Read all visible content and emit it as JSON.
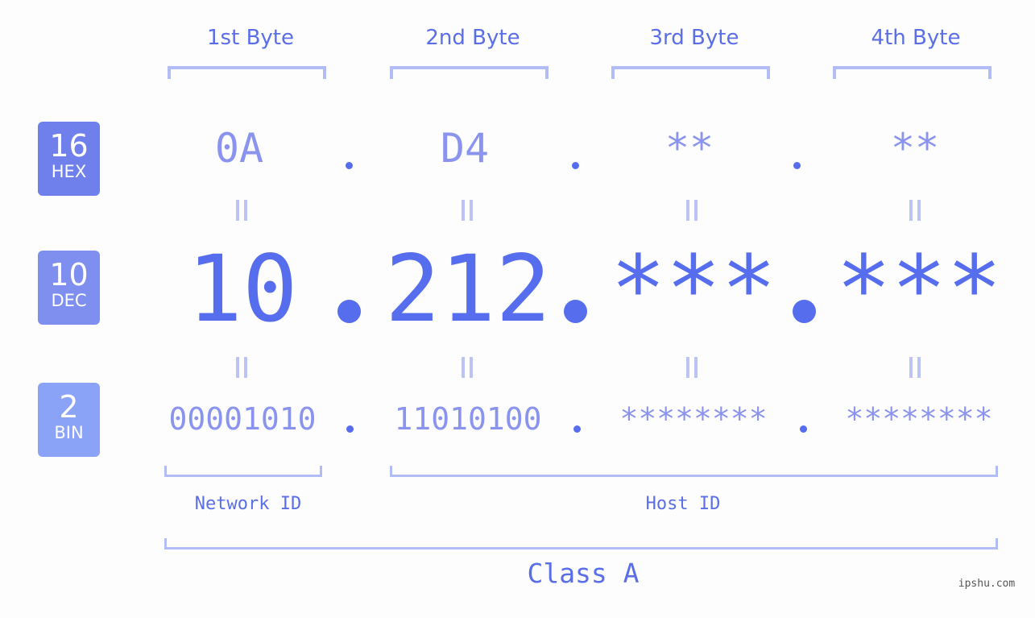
{
  "bytes": [
    {
      "label": "1st Byte",
      "hex": "0A",
      "dec": "10",
      "bin": "00001010"
    },
    {
      "label": "2nd Byte",
      "hex": "D4",
      "dec": "212",
      "bin": "11010100"
    },
    {
      "label": "3rd Byte",
      "hex": "**",
      "dec": "***",
      "bin": "********"
    },
    {
      "label": "4th Byte",
      "hex": "**",
      "dec": "***",
      "bin": "********"
    }
  ],
  "badges": {
    "hex": {
      "num": "16",
      "unit": "HEX",
      "color": "#6f80ec"
    },
    "dec": {
      "num": "10",
      "unit": "DEC",
      "color": "#7f8ff0"
    },
    "bin": {
      "num": "2",
      "unit": "BIN",
      "color": "#8aa3f7"
    }
  },
  "labels": {
    "network_id": "Network ID",
    "host_id": "Host ID",
    "class": "Class A"
  },
  "watermark": "ipshu.com",
  "colors": {
    "primary": "#566ded",
    "secondary": "#8a94ee",
    "bracket": "#b3bdf5"
  }
}
